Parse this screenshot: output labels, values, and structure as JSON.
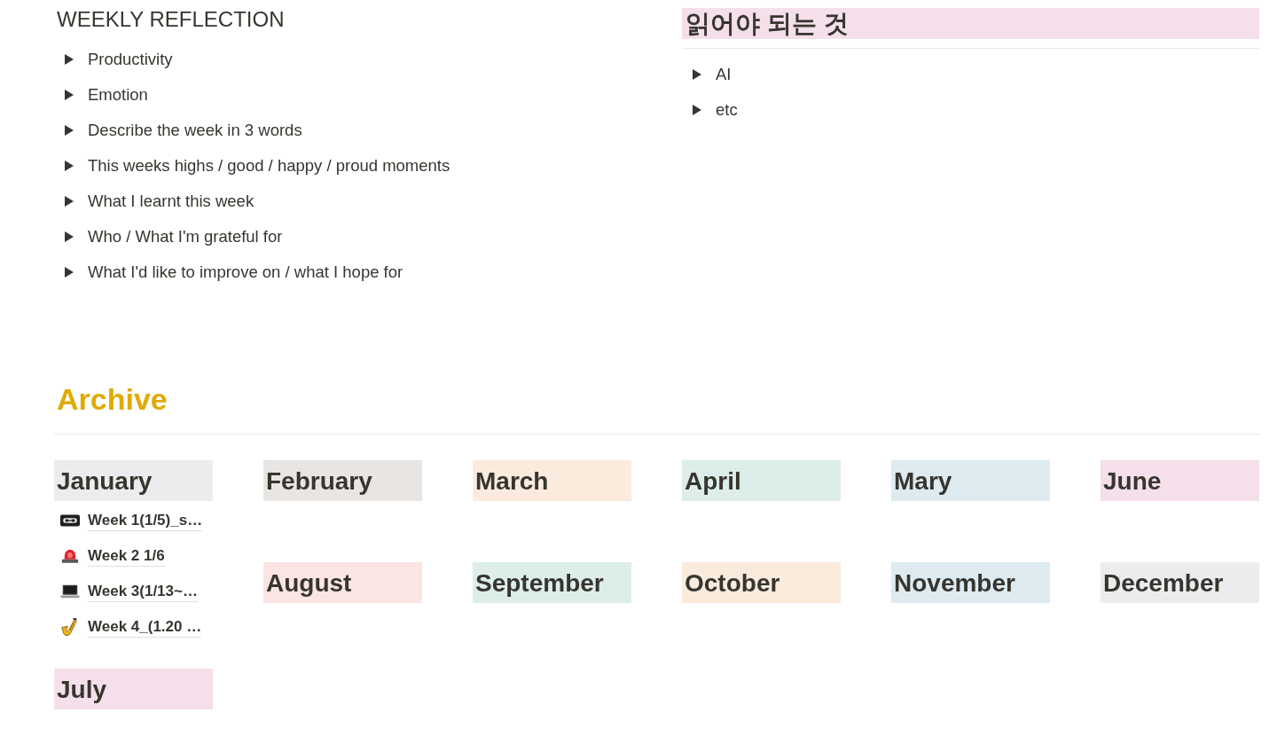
{
  "reflection": {
    "title": "WEEKLY REFLECTION",
    "toggles": [
      {
        "label": "Productivity",
        "expanded": false
      },
      {
        "label": "Emotion",
        "expanded": false
      },
      {
        "label": "Describe the week in 3 words",
        "expanded": false
      },
      {
        "label": "This weeks highs / good / happy / proud moments",
        "expanded": false
      },
      {
        "label": "What I learnt this week",
        "expanded": false
      },
      {
        "label": "Who / What I'm grateful for",
        "expanded": false
      },
      {
        "label": "What I'd like to improve on / what I hope for",
        "expanded": false
      }
    ]
  },
  "reading_list": {
    "title": "읽어야 되는 것",
    "toggles": [
      {
        "label": "AI",
        "expanded": false
      },
      {
        "label": "etc",
        "expanded": false
      }
    ]
  },
  "archive": {
    "title": "Archive",
    "columns": [
      {
        "months": [
          {
            "name": "January",
            "color": "#ebeced",
            "weeks": [
              {
                "kind": "cassette",
                "title": "Week 1(1/5)_s…"
              },
              {
                "kind": "siren",
                "title": "Week 2 1/6"
              },
              {
                "kind": "laptop",
                "title": "Week 3(1/13~…"
              },
              {
                "kind": "saxophone",
                "title": "Week 4_(1.20 …"
              }
            ]
          },
          {
            "name": "July",
            "color": "#f4dfeb"
          }
        ]
      },
      {
        "months": [
          {
            "name": "February",
            "color": "#e9e5e3"
          },
          {
            "name": "August",
            "color": "#fbe4e4"
          }
        ]
      },
      {
        "months": [
          {
            "name": "March",
            "color": "#faebdd"
          },
          {
            "name": "September",
            "color": "#ddedea"
          }
        ]
      },
      {
        "months": [
          {
            "name": "April",
            "color": "#ddedea"
          },
          {
            "name": "October",
            "color": "#faebdd"
          }
        ]
      },
      {
        "months": [
          {
            "name": "Mary",
            "color": "#ddebf1"
          },
          {
            "name": "November",
            "color": "#ddebf1"
          }
        ]
      },
      {
        "months": [
          {
            "name": "June",
            "color": "#f4dfeb"
          },
          {
            "name": "December",
            "color": "#ebeced"
          }
        ]
      }
    ]
  }
}
